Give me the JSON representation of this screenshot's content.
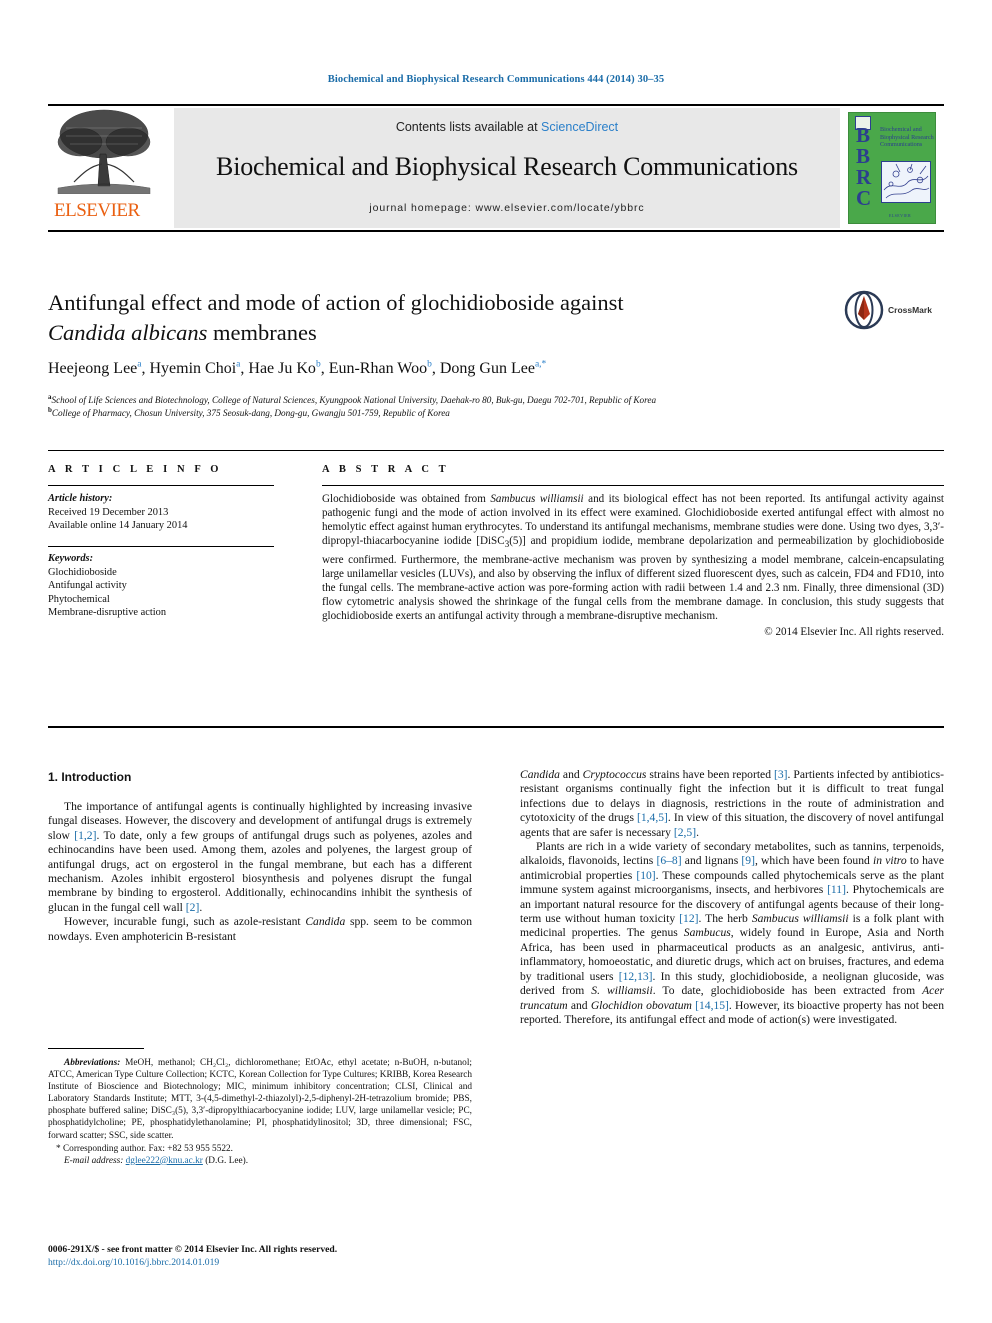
{
  "running_head": "Biochemical and Biophysical Research Communications 444 (2014) 30–35",
  "masthead": {
    "publisher": "ELSEVIER",
    "contents_prefix": "Contents lists available at ",
    "contents_link": "ScienceDirect",
    "journal_name": "Biochemical and Biophysical Research Communications",
    "homepage": "journal homepage: www.elsevier.com/locate/ybbrc",
    "cover_letters": "BBRC",
    "cover_title": "Biochemical and Biophysical Research Communications",
    "cover_footer": "ELSEVIER"
  },
  "article": {
    "title_line1": "Antifungal effect and mode of action of glochidioboside against",
    "title_line2_italic": "Candida albicans",
    "title_line2_rest": " membranes",
    "crossmark_label": "CrossMark",
    "authors": [
      {
        "name": "Heejeong Lee",
        "sup": "a",
        "sep": ", "
      },
      {
        "name": "Hyemin Choi",
        "sup": "a",
        "sep": ", "
      },
      {
        "name": "Hae Ju Ko",
        "sup": "b",
        "sep": ", "
      },
      {
        "name": "Eun-Rhan Woo",
        "sup": "b",
        "sep": ", "
      },
      {
        "name": "Dong Gun Lee",
        "sup": "a,*",
        "sep": ""
      }
    ],
    "affiliation_a_sup": "a",
    "affiliation_a": "School of Life Sciences and Biotechnology, College of Natural Sciences, Kyungpook National University, Daehak-ro 80, Buk-gu, Daegu 702-701, Republic of Korea",
    "affiliation_b_sup": "b",
    "affiliation_b": "College of Pharmacy, Chosun University, 375 Seosuk-dang, Dong-gu, Gwangju 501-759, Republic of Korea"
  },
  "article_info": {
    "heading": "A R T I C L E    I N F O",
    "history_label": "Article history:",
    "received": "Received 19 December 2013",
    "available_online": "Available online 14 January 2014",
    "keywords_label": "Keywords:",
    "keywords": [
      "Glochidioboside",
      "Antifungal activity",
      "Phytochemical",
      "Membrane-disruptive action"
    ]
  },
  "abstract": {
    "heading": "A B S T R A C T",
    "part1": "Glochidioboside was obtained from ",
    "italic1": "Sambucus williamsii",
    "part2": " and its biological effect has not been reported. Its antifungal activity against pathogenic fungi and the mode of action involved in its effect were examined. Glochidioboside exerted antifungal effect with almost no hemolytic effect against human erythrocytes. To understand its antifungal mechanisms, membrane studies were done. Using two dyes, 3,3′-dipropyl-thiacarbocyanine iodide [DiSC",
    "sub1": "3",
    "part3": "(5)] and propidium iodide, membrane depolarization and permeabilization by glochidioboside were confirmed. Furthermore, the membrane-active mechanism was proven by synthesizing a model membrane, calcein-encapsulating large unilamellar vesicles (LUVs), and also by observing the influx of different sized fluorescent dyes, such as calcein, FD4 and FD10, into the fungal cells. The membrane-active action was pore-forming action with radii between 1.4 and 2.3 nm. Finally, three dimensional (3D) flow cytometric analysis showed the shrinkage of the fungal cells from the membrane damage. In conclusion, this study suggests that glochidioboside exerts an antifungal activity through a membrane-disruptive mechanism.",
    "copyright": "© 2014 Elsevier Inc. All rights reserved."
  },
  "body": {
    "section_title": "1. Introduction",
    "left_p1_a": "The importance of antifungal agents is continually highlighted by increasing invasive fungal diseases. However, the discovery and development of antifungal drugs is extremely slow ",
    "left_p1_ref1": "[1,2]",
    "left_p1_b": ". To date, only a few groups of antifungal drugs such as polyenes, azoles and echinocandins have been used. Among them, azoles and polyenes, the largest group of antifungal drugs, act on ergosterol in the fungal membrane, but each has a different mechanism. Azoles inhibit ergosterol biosynthesis and polyenes disrupt the fungal membrane by binding to ergosterol. Additionally, echinocandins inhibit the synthesis of glucan in the fungal cell wall ",
    "left_p1_ref2": "[2]",
    "left_p1_c": ".",
    "left_p2_a": "However, incurable fungi, such as azole-resistant ",
    "left_p2_ital": "Candida",
    "left_p2_b": " spp. seem to be common nowdays. Even amphotericin B-resistant",
    "right_p1_ital1": "Candida",
    "right_p1_a": " and ",
    "right_p1_ital2": "Cryptococcus",
    "right_p1_b": " strains have been reported ",
    "right_p1_ref1": "[3]",
    "right_p1_c": ". Partients infected by antibiotics-resistant organisms continually fight the infection but it is difficult to treat fungal infections due to delays in diagnosis, restrictions in the route of administration and cytotoxicity of the drugs ",
    "right_p1_ref2": "[1,4,5]",
    "right_p1_d": ". In view of this situation, the discovery of novel antifungal agents that are safer is necessary ",
    "right_p1_ref3": "[2,5]",
    "right_p1_e": ".",
    "right_p2_a": "Plants are rich in a wide variety of secondary metabolites, such as tannins, terpenoids, alkaloids, flavonoids, lectins ",
    "right_p2_ref1": "[6–8]",
    "right_p2_b": " and lignans ",
    "right_p2_ref2": "[9]",
    "right_p2_c": ", which have been found ",
    "right_p2_ital1": "in vitro",
    "right_p2_d": " to have antimicrobial properties ",
    "right_p2_ref3": "[10]",
    "right_p2_e": ". These compounds called phytochemicals serve as the plant immune system against microorganisms, insects, and herbivores ",
    "right_p2_ref4": "[11]",
    "right_p2_f": ". Phytochemicals are an important natural resource for the discovery of antifungal agents because of their long-term use without human toxicity ",
    "right_p2_ref5": "[12]",
    "right_p2_g": ". The herb ",
    "right_p2_ital2": "Sambucus williamsii",
    "right_p2_h": " is a folk plant with medicinal properties. The genus ",
    "right_p2_ital3": "Sambucus",
    "right_p2_i": ", widely found in Europe, Asia and North Africa, has been used in pharmaceutical products as an analgesic, antivirus, anti-inflammatory, homoeostatic, and diuretic drugs, which act on bruises, fractures, and edema by traditional users ",
    "right_p2_ref6": "[12,13]",
    "right_p2_j": ". In this study, glochidioboside, a neolignan glucoside, was derived from ",
    "right_p2_ital4": "S. williamsii",
    "right_p2_k": ". To date, glochidioboside has been extracted from ",
    "right_p2_ital5": "Acer truncatum",
    "right_p2_l": " and ",
    "right_p2_ital6": "Glochidion obovatum",
    "right_p2_m": " ",
    "right_p2_ref7": "[14,15]",
    "right_p2_n": ". However, its bioactive property has not been reported. Therefore, its antifungal effect and mode of action(s) were investigated."
  },
  "footnotes": {
    "abbrev_label": "Abbreviations:",
    "abbrev_text": " MeOH, methanol; CH₂Cl₂, dichloromethane; EtOAc, ethyl acetate; n-BuOH, n-butanol; ATCC, American Type Culture Collection; KCTC, Korean Collection for Type Cultures; KRIBB, Korea Research Institute of Bioscience and Biotechnology; MIC, minimum inhibitory concentration; CLSI, Clinical and Laboratory Standards Institute; MTT, 3-(4,5-dimethyl-2-thiazolyl)-2,5-diphenyl-2H-tetrazolium bromide; PBS, phosphate buffered saline; DiSC₃(5), 3,3′-dipropylthiacarbocyanine iodide; LUV, large unilamellar vesicle; PC, phosphatidylcholine; PE, phosphatidylethanolamine; PI, phosphatidylinositol; 3D, three dimensional; FSC, forward scatter; SSC, side scatter.",
    "corresponding": "* Corresponding author. Fax: +82 53 955 5522.",
    "email_label": "E-mail address:",
    "email": "dglee222@knu.ac.kr",
    "email_suffix": " (D.G. Lee)."
  },
  "footer": {
    "issn_line": "0006-291X/$ - see front matter © 2014 Elsevier Inc. All rights reserved.",
    "doi": "http://dx.doi.org/10.1016/j.bbrc.2014.01.019"
  }
}
